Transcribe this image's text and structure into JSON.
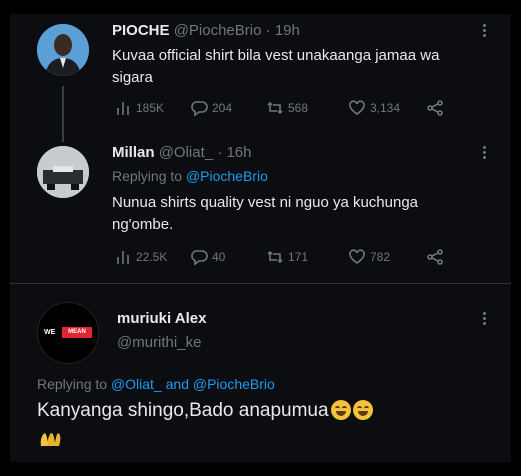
{
  "tweets": [
    {
      "name": "PIOCHE",
      "handle": "@PiocheBrio",
      "time": "19h",
      "text_line1": "Kuvaa official shirt bila vest unakaanga jamaa wa",
      "text_line2": "sigara",
      "views": "185K",
      "replies": "204",
      "retweets": "568",
      "likes": "3,134"
    },
    {
      "name": "Millan",
      "handle": "@Oliat_",
      "time": "16h",
      "replying_label": "Replying to",
      "replying_to": "@PiocheBrio",
      "text_line1": "Nunua shirts quality vest ni nguo ya kuchunga",
      "text_line2": "ng'ombe.",
      "views": "22.5K",
      "replies": "40",
      "retweets": "171",
      "likes": "782"
    },
    {
      "name": "muriuki Alex",
      "handle": "@murithi_ke",
      "avatar_text_left": "WE",
      "avatar_text_right": "MEAN",
      "replying_label": "Replying to",
      "replying_to_1": "@Oliat_",
      "replying_and": "and",
      "replying_to_2": "@PiocheBrio",
      "text": "Kanyanga shingo,Bado anapumua"
    }
  ],
  "icons": [
    "views-icon",
    "reply-icon",
    "retweet-icon",
    "like-icon",
    "share-icon",
    "more-icon",
    "laughing-emoji-icon",
    "raised-hands-icon"
  ],
  "colors": {
    "background": "#0c0d10",
    "text": "#e7e9ea",
    "muted": "#71767b",
    "link": "#1d9bf0"
  }
}
